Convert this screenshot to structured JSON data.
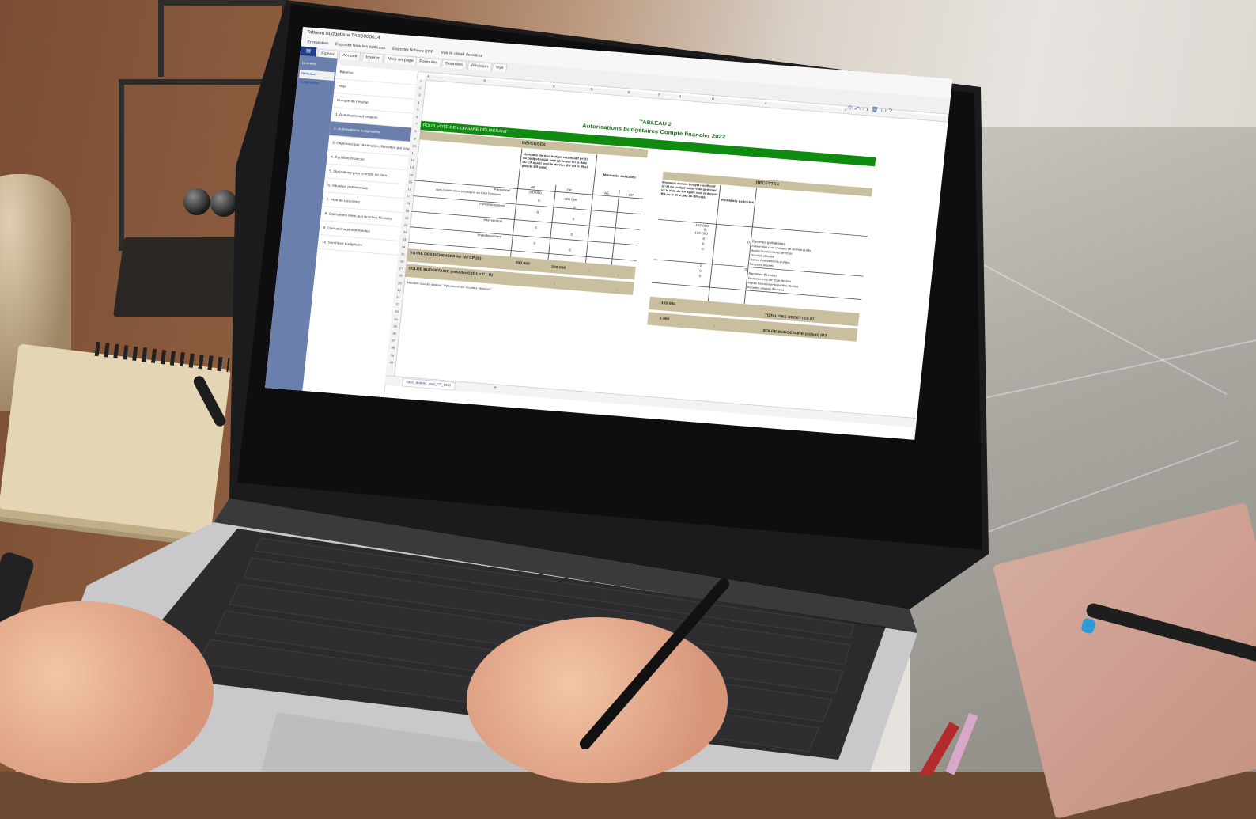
{
  "app": {
    "window_title": "Tableau budgétaire TAB0000014",
    "quick_actions": [
      "Enregistrer",
      "Exporter tous les tableaux",
      "Exporter fichiers EPR",
      "Voir le détail du calcul"
    ]
  },
  "ribbon": {
    "file_label": "Fichier",
    "tabs": [
      "Accueil",
      "Insérer",
      "Mise en page",
      "Formules",
      "Données",
      "Révision",
      "Vue"
    ]
  },
  "left_nav": {
    "items": [
      "Données",
      "Tableaux budgétaires"
    ],
    "active_index": 1
  },
  "sheet_list": {
    "items": [
      "Balance",
      "Bilan",
      "Compte de résultat",
      "1. Autorisations d'emplois",
      "2. Autorisations budgétaires",
      "3. Dépenses par destination, Recettes par origine",
      "4. Équilibre financier",
      "5. Opérations pour compte de tiers",
      "6. Situation patrimoniale",
      "7. Plan de trésorerie",
      "8. Opérations liées aux recettes fléchées",
      "9. Opérations pluriannuelles",
      "10. Synthèse budgétaire"
    ],
    "active_index": 4
  },
  "grid": {
    "column_headers": [
      "A",
      "B",
      "C",
      "D",
      "E",
      "F",
      "G",
      "H",
      "I",
      "J"
    ],
    "row_headers": [
      "1",
      "2",
      "3",
      "4",
      "5",
      "6",
      "7",
      "8",
      "9",
      "10",
      "11",
      "12",
      "13",
      "14",
      "15",
      "16",
      "17",
      "18",
      "19",
      "20",
      "21",
      "22",
      "23",
      "24",
      "25",
      "26",
      "27",
      "28",
      "29",
      "30",
      "31",
      "32",
      "33",
      "34",
      "35",
      "36",
      "37",
      "38",
      "39",
      "40"
    ]
  },
  "sheet": {
    "title_line1": "TABLEAU 2",
    "title_line2": "Autorisations budgétaires Compte financier 2022",
    "green_banner": "POUR VOTE DE L'ORGANE DÉLIBÉRANT",
    "depenses": {
      "header": "DÉPENSES",
      "col_budget": "Montants dernier budget rectificatif (n°X) ou budget initial voté (préciser ici la date du CA ayant voté le dernier BR ou le BI si pas de BR voté)",
      "col_executes": "Montants exécutés",
      "sub_ae": "AE",
      "sub_cp": "CP",
      "rows": [
        {
          "label": "Personnel",
          "ae": "200 000",
          "cp": "200 000"
        },
        {
          "label": "dont contributions employeur au CAS Pensions",
          "ae": "0",
          "cp": "0"
        },
        {
          "label": "Fonctionnement",
          "ae": "0",
          "cp": "0"
        },
        {
          "label": "Intervention",
          "ae": "0",
          "cp": "0"
        },
        {
          "label": "Investissement",
          "ae": "0",
          "cp": "0"
        }
      ],
      "total_label": "TOTAL DES DÉPENSES AE (A) CP (B)",
      "total_ae": "200 000",
      "total_cp": "200 000",
      "solde_label": "SOLDE BUDGÉTAIRE (excédent) (D1 = C - B)",
      "dash": "-"
    },
    "recettes": {
      "header": "RECETTES",
      "col_budget": "Montants dernier budget rectificatif (n°X) ou budget initial voté (préciser ici la date du CA ayant voté le dernier BR ou le BI si pas de BR voté)",
      "col_executes": "Montants exécutés",
      "values": [
        "155 000",
        "0",
        "155 000",
        "0",
        "0",
        "0",
        "0",
        "0",
        "0",
        "0",
        "0"
      ],
      "rows": [
        "Recettes globalisées",
        "Subvention pour charges de service public",
        "Autres financements de l'État",
        "Fiscalité affectée",
        "Autres financements publics",
        "Recettes propres",
        "Recettes fléchées",
        "Financements de l'État fléchés",
        "Autres financements publics fléchés",
        "Recettes propres fléchées"
      ],
      "total_value": "155 000",
      "total_label": "TOTAL DES RECETTES (C)",
      "solde_value": "5 000",
      "solde_label": "SOLDE BUDGÉTAIRE (déficit) (D2"
    },
    "footnote": "Montant issu du tableau \"Opérations sur recettes fléchées\""
  },
  "sheet_tab": {
    "label": "tab2_autoris_bud_CF_DCB",
    "add": "+"
  },
  "colors": {
    "green": "#118a11",
    "tan": "#c9bf9f",
    "nav_blue": "#6b7fad",
    "title_green": "#1f6b1f"
  }
}
